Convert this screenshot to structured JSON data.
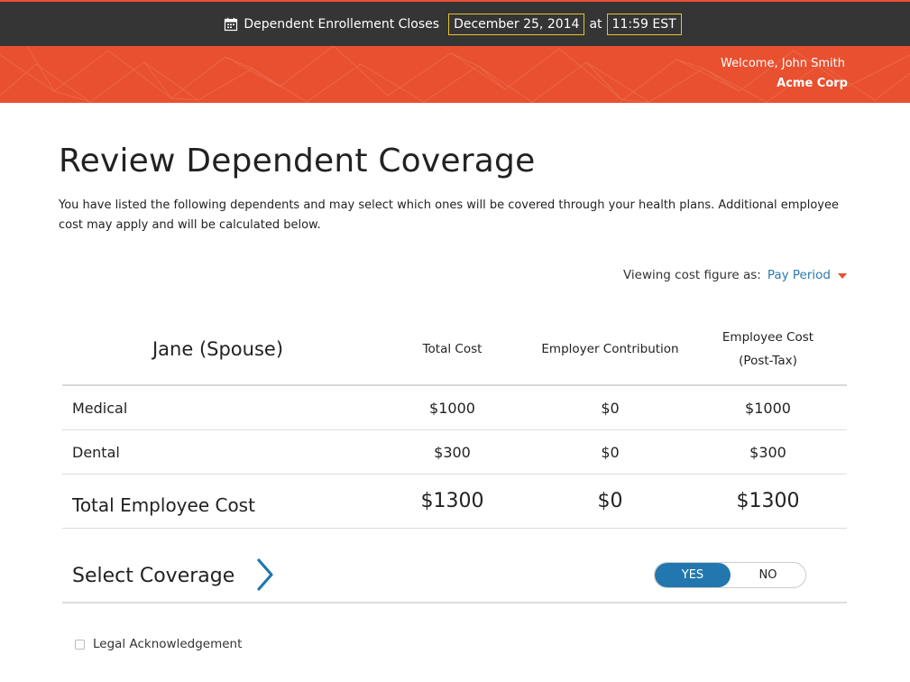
{
  "topbar": {
    "icon": "calendar-icon",
    "label": "Dependent Enrollement Closes",
    "date": "December 25, 2014",
    "at": "at",
    "time": "11:59 EST"
  },
  "header": {
    "welcome": "Welcome, John Smith",
    "company": "Acme Corp"
  },
  "page": {
    "title": "Review Dependent Coverage",
    "description": "You have listed the following dependents and may select which ones will be covered through your health plans. Additional employee cost may apply and will be calculated below."
  },
  "viewing": {
    "label": "Viewing cost figure as:",
    "selected": "Pay Period"
  },
  "table": {
    "dependent": "Jane (Spouse)",
    "columns": [
      "Total Cost",
      "Employer Contribution",
      "Employee Cost",
      "(Post-Tax)"
    ],
    "rows": [
      {
        "plan": "Medical",
        "total": "$1000",
        "employer": "$0",
        "employee": "$1000"
      },
      {
        "plan": "Dental",
        "total": "$300",
        "employer": "$0",
        "employee": "$300"
      }
    ],
    "total_row": {
      "label": "Total Employee Cost",
      "total": "$1300",
      "employer": "$0",
      "employee": "$1300"
    }
  },
  "coverage": {
    "label": "Select Coverage",
    "yes": "YES",
    "no": "NO",
    "selected": "YES"
  },
  "legal": {
    "label": "Legal Acknowledgement",
    "checked": false
  },
  "colors": {
    "accent": "#e8502f",
    "topbar_bg": "#353535",
    "highlight_border": "#e5c32f",
    "link_blue": "#2b7bb0",
    "toggle_blue": "#2277ae"
  }
}
